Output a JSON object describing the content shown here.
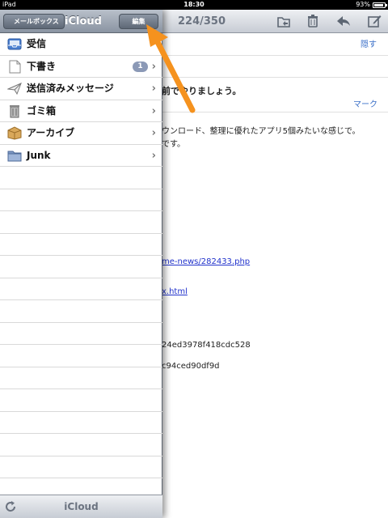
{
  "status_bar": {
    "device": "iPad",
    "time": "18:30",
    "battery": "93%"
  },
  "message": {
    "counter": "224/350",
    "hide_label": "隠す",
    "mark_label": "マーク",
    "lines": [
      "前でやりましょう。",
      "ウンロード、整理に優れたアプリ5個みたいな感じで。",
      "です。",
      "me-news/282433.php",
      "x.html",
      "24ed3978f418cdc528",
      "c94ced90df9d"
    ]
  },
  "popover": {
    "back_label": "メールボックス",
    "title": "iCloud",
    "edit_label": "編集",
    "items": [
      {
        "label": "受信",
        "icon": "inbox-icon"
      },
      {
        "label": "下書き",
        "icon": "draft-icon",
        "badge": "1"
      },
      {
        "label": "送信済みメッセージ",
        "icon": "sent-icon"
      },
      {
        "label": "ゴミ箱",
        "icon": "trash-icon"
      },
      {
        "label": "アーカイブ",
        "icon": "archive-box-icon"
      },
      {
        "label": "Junk",
        "icon": "folder-icon"
      }
    ],
    "bottom_title": "iCloud"
  },
  "colors": {
    "annotation_arrow": "#f5921e",
    "badge": "#8b99b6",
    "link": "#2233cc"
  }
}
